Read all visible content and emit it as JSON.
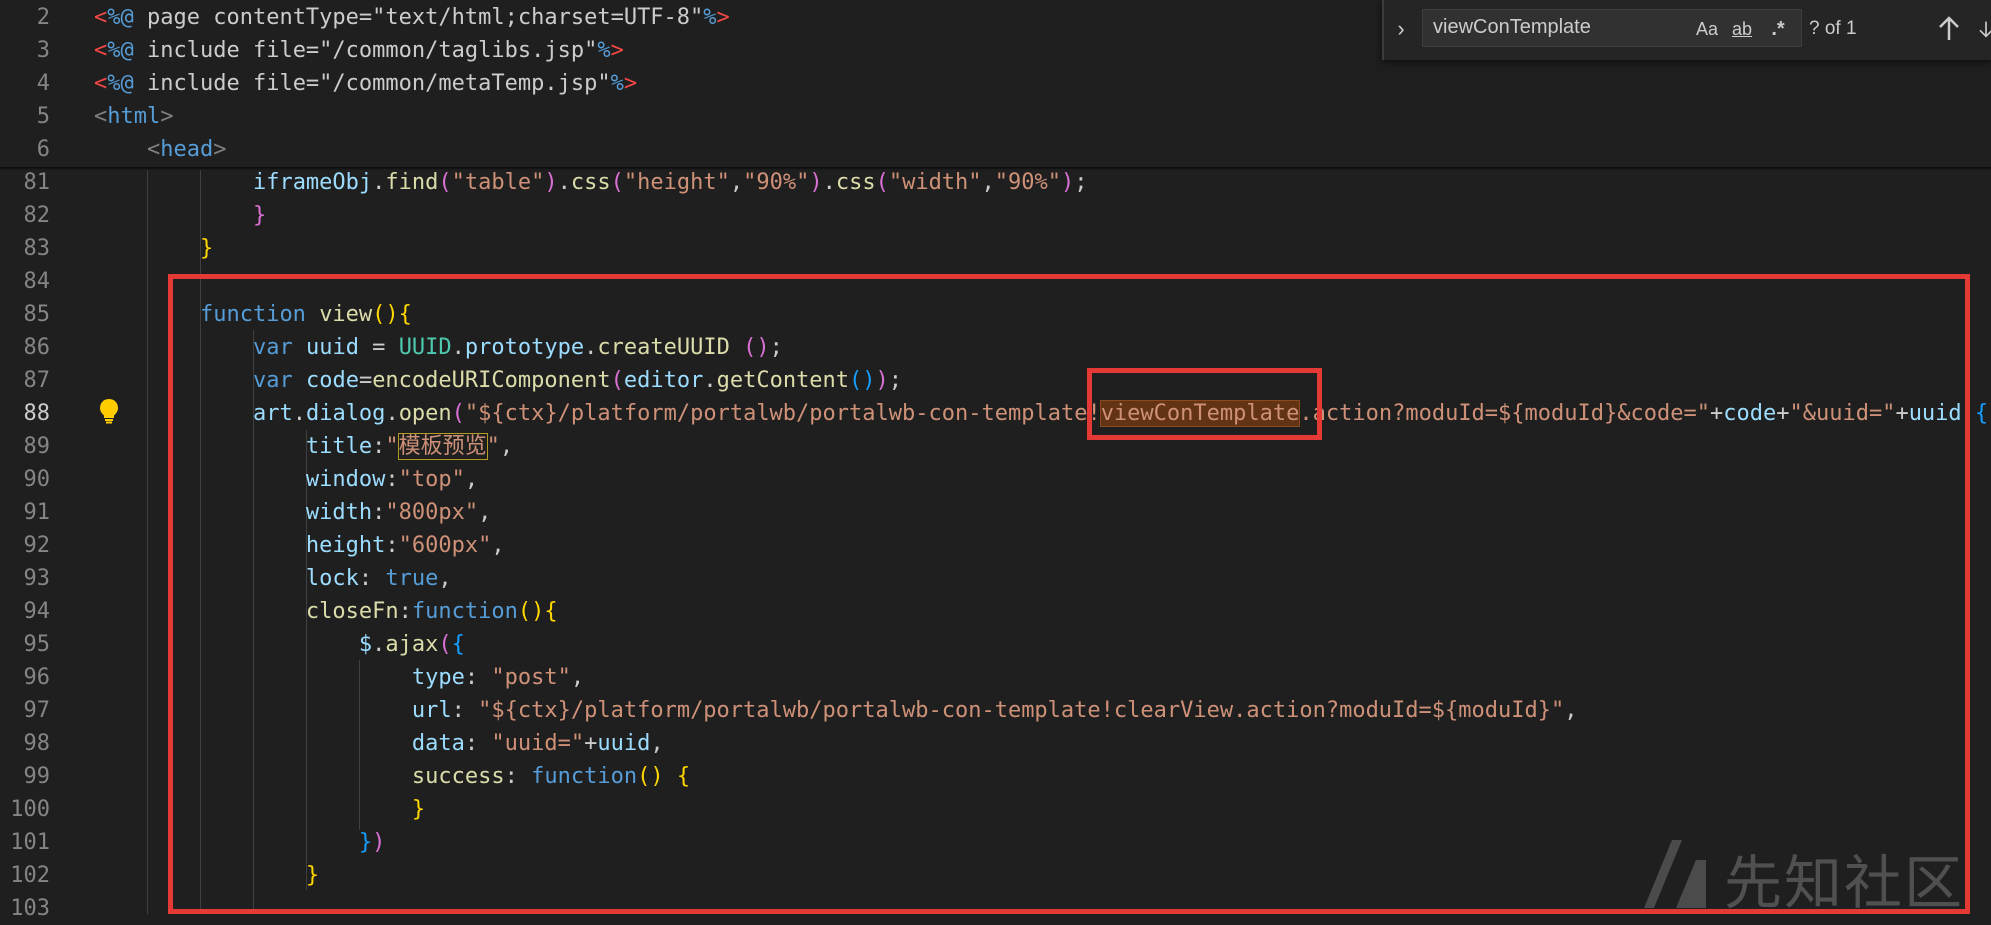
{
  "sticky_lines": [
    {
      "num": "2",
      "parts": [
        [
          "red",
          "<"
        ],
        [
          "jsp",
          "%@"
        ],
        [
          "plain",
          " page contentType=\"text/html;charset=UTF-8\""
        ],
        [
          "jsp",
          "%"
        ],
        [
          "red",
          ">"
        ]
      ]
    },
    {
      "num": "3",
      "parts": [
        [
          "red",
          "<"
        ],
        [
          "jsp",
          "%@"
        ],
        [
          "plain",
          " include file=\"/common/taglibs.jsp\""
        ],
        [
          "jsp",
          "%"
        ],
        [
          "red",
          ">"
        ]
      ]
    },
    {
      "num": "4",
      "parts": [
        [
          "red",
          "<"
        ],
        [
          "jsp",
          "%@"
        ],
        [
          "plain",
          " include file=\"/common/metaTemp.jsp\""
        ],
        [
          "jsp",
          "%"
        ],
        [
          "red",
          ">"
        ]
      ]
    },
    {
      "num": "5",
      "parts": [
        [
          "tagb",
          "<"
        ],
        [
          "tag",
          "html"
        ],
        [
          "tagb",
          ">"
        ]
      ]
    },
    {
      "num": "6",
      "parts": [
        [
          "plain",
          "    "
        ],
        [
          "tagb",
          "<"
        ],
        [
          "tag",
          "head"
        ],
        [
          "tagb",
          ">"
        ]
      ]
    }
  ],
  "code_lines": [
    {
      "num": "81",
      "parts": [
        [
          "plain",
          "            "
        ],
        [
          "var",
          "iframeObj"
        ],
        [
          "plain",
          "."
        ],
        [
          "fn",
          "find"
        ],
        [
          "p2",
          "("
        ],
        [
          "str",
          "\"table\""
        ],
        [
          "p2",
          ")"
        ],
        [
          "plain",
          "."
        ],
        [
          "fn",
          "css"
        ],
        [
          "p2",
          "("
        ],
        [
          "str",
          "\"height\""
        ],
        [
          "plain",
          ","
        ],
        [
          "str",
          "\"90%\""
        ],
        [
          "p2",
          ")"
        ],
        [
          "plain",
          "."
        ],
        [
          "fn",
          "css"
        ],
        [
          "p2",
          "("
        ],
        [
          "str",
          "\"width\""
        ],
        [
          "plain",
          ","
        ],
        [
          "str",
          "\"90%\""
        ],
        [
          "p2",
          ")"
        ],
        [
          "plain",
          ";"
        ]
      ]
    },
    {
      "num": "82",
      "parts": [
        [
          "plain",
          "            "
        ],
        [
          "p2",
          "}"
        ]
      ]
    },
    {
      "num": "83",
      "parts": [
        [
          "plain",
          "        "
        ],
        [
          "p1",
          "}"
        ]
      ]
    },
    {
      "num": "84",
      "parts": [
        [
          "plain",
          ""
        ]
      ]
    },
    {
      "num": "85",
      "parts": [
        [
          "plain",
          "        "
        ],
        [
          "kw",
          "function"
        ],
        [
          "plain",
          " "
        ],
        [
          "fn",
          "view"
        ],
        [
          "p1",
          "()"
        ],
        [
          "p1",
          "{"
        ]
      ]
    },
    {
      "num": "86",
      "parts": [
        [
          "plain",
          "            "
        ],
        [
          "kw",
          "var"
        ],
        [
          "plain",
          " "
        ],
        [
          "var",
          "uuid"
        ],
        [
          "plain",
          " = "
        ],
        [
          "cls",
          "UUID"
        ],
        [
          "plain",
          "."
        ],
        [
          "var",
          "prototype"
        ],
        [
          "plain",
          "."
        ],
        [
          "fn",
          "createUUID"
        ],
        [
          "plain",
          " "
        ],
        [
          "p2",
          "()"
        ],
        [
          "plain",
          ";"
        ]
      ]
    },
    {
      "num": "87",
      "parts": [
        [
          "plain",
          "            "
        ],
        [
          "kw",
          "var"
        ],
        [
          "plain",
          " "
        ],
        [
          "var",
          "code"
        ],
        [
          "plain",
          "="
        ],
        [
          "fn",
          "encodeURIComponent"
        ],
        [
          "p2",
          "("
        ],
        [
          "var",
          "editor"
        ],
        [
          "plain",
          "."
        ],
        [
          "fn",
          "getContent"
        ],
        [
          "p3",
          "()"
        ],
        [
          "p2",
          ")"
        ],
        [
          "plain",
          ";"
        ]
      ]
    },
    {
      "num": "88",
      "parts": [
        [
          "plain",
          "            "
        ],
        [
          "var",
          "art"
        ],
        [
          "plain",
          "."
        ],
        [
          "var",
          "dialog"
        ],
        [
          "plain",
          "."
        ],
        [
          "fn",
          "open"
        ],
        [
          "p2",
          "("
        ],
        [
          "str",
          "\"${ctx}/platform/portalwb/portalwb-con-template!"
        ],
        [
          "strmatch",
          "viewConTemplate"
        ],
        [
          "str",
          ".action?moduId=${moduId}&code=\""
        ],
        [
          "plain",
          "+"
        ],
        [
          "var",
          "code"
        ],
        [
          "plain",
          "+"
        ],
        [
          "str",
          "\"&uuid=\""
        ],
        [
          "plain",
          "+"
        ],
        [
          "var",
          "uuid"
        ],
        [
          "plain",
          " "
        ],
        [
          "p3",
          "{"
        ]
      ]
    },
    {
      "num": "89",
      "parts": [
        [
          "plain",
          "                "
        ],
        [
          "var",
          "title"
        ],
        [
          "plain",
          ":"
        ],
        [
          "str",
          "\""
        ],
        [
          "strword",
          "模板预览"
        ],
        [
          "str",
          "\""
        ],
        [
          "plain",
          ","
        ]
      ]
    },
    {
      "num": "90",
      "parts": [
        [
          "plain",
          "                "
        ],
        [
          "var",
          "window"
        ],
        [
          "plain",
          ":"
        ],
        [
          "str",
          "\"top\""
        ],
        [
          "plain",
          ","
        ]
      ]
    },
    {
      "num": "91",
      "parts": [
        [
          "plain",
          "                "
        ],
        [
          "var",
          "width"
        ],
        [
          "plain",
          ":"
        ],
        [
          "str",
          "\"800px\""
        ],
        [
          "plain",
          ","
        ]
      ]
    },
    {
      "num": "92",
      "parts": [
        [
          "plain",
          "                "
        ],
        [
          "var",
          "height"
        ],
        [
          "plain",
          ":"
        ],
        [
          "str",
          "\"600px\""
        ],
        [
          "plain",
          ","
        ]
      ]
    },
    {
      "num": "93",
      "parts": [
        [
          "plain",
          "                "
        ],
        [
          "var",
          "lock"
        ],
        [
          "plain",
          ": "
        ],
        [
          "kw",
          "true"
        ],
        [
          "plain",
          ","
        ]
      ]
    },
    {
      "num": "94",
      "parts": [
        [
          "plain",
          "                "
        ],
        [
          "fn",
          "closeFn"
        ],
        [
          "plain",
          ":"
        ],
        [
          "kw",
          "function"
        ],
        [
          "p1",
          "()"
        ],
        [
          "p1",
          "{"
        ]
      ]
    },
    {
      "num": "95",
      "parts": [
        [
          "plain",
          "                    "
        ],
        [
          "var",
          "$"
        ],
        [
          "plain",
          "."
        ],
        [
          "fn",
          "ajax"
        ],
        [
          "p2",
          "("
        ],
        [
          "p3",
          "{"
        ]
      ]
    },
    {
      "num": "96",
      "parts": [
        [
          "plain",
          "                        "
        ],
        [
          "var",
          "type"
        ],
        [
          "plain",
          ": "
        ],
        [
          "str",
          "\"post\""
        ],
        [
          "plain",
          ","
        ]
      ]
    },
    {
      "num": "97",
      "parts": [
        [
          "plain",
          "                        "
        ],
        [
          "var",
          "url"
        ],
        [
          "plain",
          ": "
        ],
        [
          "str",
          "\"${ctx}/platform/portalwb/portalwb-con-template!clearView.action?moduId=${moduId}\""
        ],
        [
          "plain",
          ","
        ]
      ]
    },
    {
      "num": "98",
      "parts": [
        [
          "plain",
          "                        "
        ],
        [
          "var",
          "data"
        ],
        [
          "plain",
          ": "
        ],
        [
          "str",
          "\"uuid=\""
        ],
        [
          "plain",
          "+"
        ],
        [
          "var",
          "uuid"
        ],
        [
          "plain",
          ","
        ]
      ]
    },
    {
      "num": "99",
      "parts": [
        [
          "plain",
          "                        "
        ],
        [
          "fn",
          "success"
        ],
        [
          "plain",
          ": "
        ],
        [
          "kw",
          "function"
        ],
        [
          "p1",
          "()"
        ],
        [
          "plain",
          " "
        ],
        [
          "p1",
          "{"
        ]
      ]
    },
    {
      "num": "100",
      "parts": [
        [
          "plain",
          "                        "
        ],
        [
          "p1",
          "}"
        ]
      ]
    },
    {
      "num": "101",
      "parts": [
        [
          "plain",
          "                    "
        ],
        [
          "p3",
          "}"
        ],
        [
          "p2",
          ")"
        ]
      ]
    },
    {
      "num": "102",
      "parts": [
        [
          "plain",
          "                "
        ],
        [
          "p1",
          "}"
        ]
      ]
    },
    {
      "num": "103",
      "parts": [
        [
          "plain",
          ""
        ]
      ]
    }
  ],
  "active_line": "88",
  "find_widget": {
    "query": "viewConTemplate",
    "match_case_label": "Aa",
    "whole_word_label": "ab",
    "regex_label": ".*",
    "count": "? of 1"
  },
  "watermark": {
    "text": "先知社区"
  },
  "colors": {
    "annotation": "#e53935",
    "background": "#1f1f1f"
  }
}
